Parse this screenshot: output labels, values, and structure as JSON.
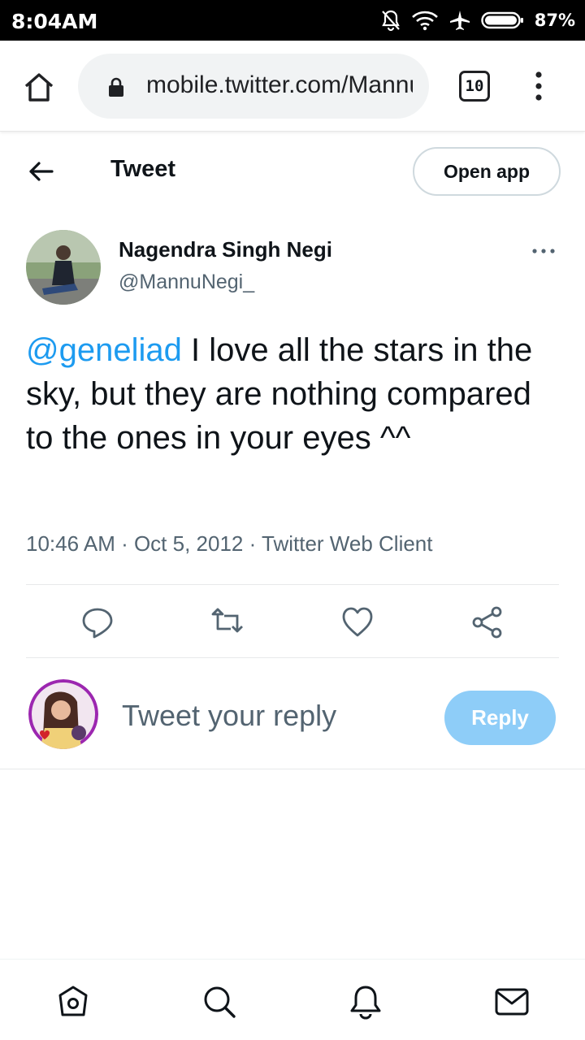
{
  "status_bar": {
    "time": "8:04AM",
    "battery": "87%",
    "icons": [
      "notifications-off-icon",
      "wifi-icon",
      "airplane-icon",
      "battery-icon"
    ]
  },
  "browser": {
    "url": "mobile.twitter.com/Mannu",
    "tab_count": "10",
    "icons": [
      "home-icon",
      "lock-icon",
      "menu-icon"
    ]
  },
  "header": {
    "title": "Tweet",
    "open_app": "Open app"
  },
  "tweet": {
    "author_name": "Nagendra Singh Negi",
    "author_handle": "@MannuNegi_",
    "mention": "@geneliad",
    "text": " I love all the stars in the sky, but they are nothing compared to the ones in your eyes ^^",
    "meta": "10:46 AM · Oct 5, 2012 · Twitter Web Client"
  },
  "actions": [
    "reply-icon",
    "retweet-icon",
    "like-icon",
    "share-icon"
  ],
  "reply": {
    "placeholder": "Tweet your reply",
    "button": "Reply"
  },
  "colors": {
    "accent": "#1d9bf0",
    "reply_button_disabled": "#8ecdf8",
    "secondary_text": "#536471"
  },
  "bottom_nav": [
    "home-icon",
    "search-icon",
    "notifications-icon",
    "messages-icon"
  ]
}
